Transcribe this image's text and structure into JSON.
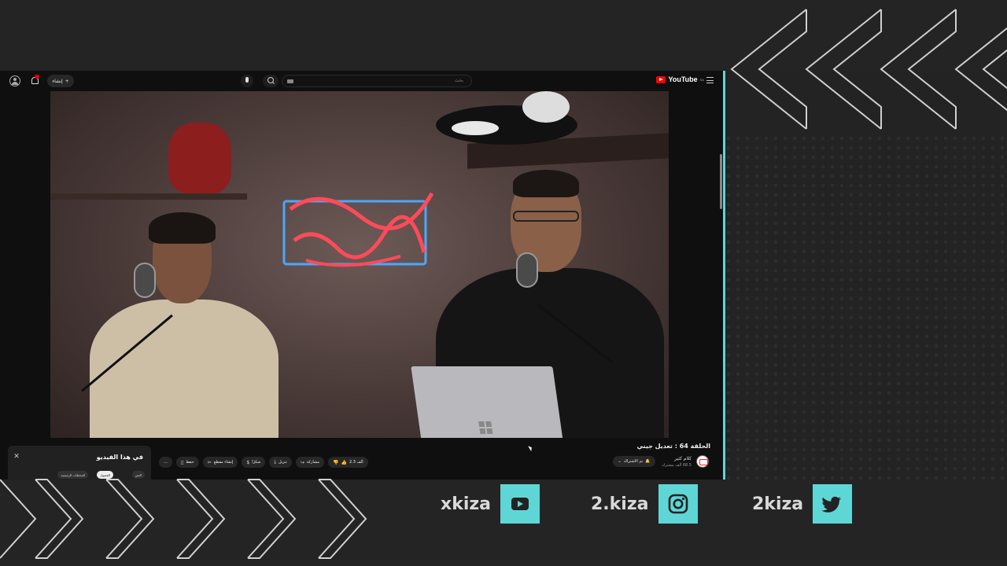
{
  "youtube": {
    "logo_text": "YouTube",
    "logo_region": "SA",
    "search_placeholder": "بحث",
    "create_label": "إنشاء",
    "video": {
      "title": "الحلقة 64 : تعديل جيني",
      "channel_name": "كلام كثير",
      "channel_subs": "68.5 ألف مشترك",
      "subscribe_label": "تم الاشتراك",
      "actions": {
        "like": "2.3 ألف",
        "share": "مشاركة",
        "download": "تنزيل",
        "thanks": "شكرًا",
        "clip": "إنشاء مقطع",
        "save": "حفظ",
        "more": "…"
      }
    },
    "panel": {
      "title": "في هذا الفيديو",
      "close": "✕",
      "chips": [
        "النص",
        "الفصول",
        "المحطات الرئيسية"
      ]
    }
  },
  "social": {
    "youtube_handle": "xkiza",
    "instagram_handle": "2.kiza",
    "twitter_handle": "2kiza"
  },
  "colors": {
    "accent": "#5fd6d6",
    "background": "#242424",
    "youtube_red": "#ff0000"
  }
}
